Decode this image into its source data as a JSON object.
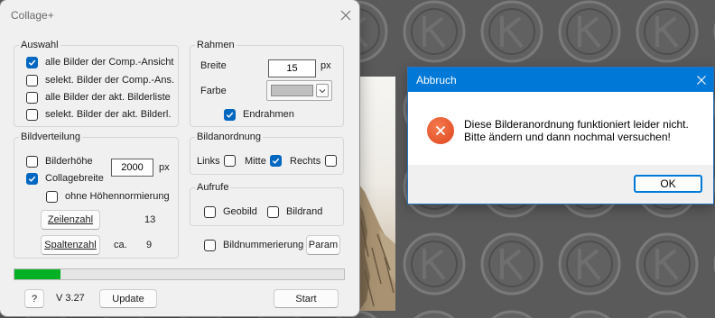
{
  "colors": {
    "checkbox_accent": "#0067c0",
    "title_bar": "#0078d7",
    "progress_fill": "#06b025",
    "error_icon": "#e0451f"
  },
  "collage_window": {
    "title": "Collage+",
    "close_icon": "close-icon",
    "auswahl": {
      "label": "Auswahl",
      "items": [
        {
          "label": "alle Bilder der Comp.-Ansicht",
          "checked": true
        },
        {
          "label": "selekt. Bilder der Comp.-Ans.",
          "checked": false
        },
        {
          "label": "alle Bilder der akt. Bilderliste",
          "checked": false
        },
        {
          "label": "selekt. Bilder der akt. Bilderl.",
          "checked": false
        }
      ]
    },
    "rahmen": {
      "label": "Rahmen",
      "breite_label": "Breite",
      "breite_value": "15",
      "breite_unit": "px",
      "farbe_label": "Farbe",
      "farbe_color": "#c0c0c0",
      "endrahmen_label": "Endrahmen",
      "endrahmen_checked": true
    },
    "bildverteilung": {
      "label": "Bildverteilung",
      "bilderhoehe_label": "Bilderhöhe",
      "bilderhoehe_checked": false,
      "size_value": "2000",
      "size_unit": "px",
      "collagebreite_label": "Collagebreite",
      "collagebreite_checked": true,
      "ohne_normierung_label": "ohne Höhennormierung",
      "ohne_normierung_checked": false,
      "zeilenzahl_button": "Zeilenzahl",
      "zeilenzahl_value": "13",
      "spaltenzahl_button": "Spaltenzahl",
      "spaltenzahl_prefix": "ca.",
      "spaltenzahl_value": "9"
    },
    "bildanordnung": {
      "label": "Bildanordnung",
      "links_label": "Links",
      "links_checked": false,
      "mitte_label": "Mitte",
      "mitte_checked": true,
      "rechts_label": "Rechts",
      "rechts_checked": false
    },
    "aufrufe": {
      "label": "Aufrufe",
      "geobild_label": "Geobild",
      "geobild_checked": false,
      "bildrand_label": "Bildrand",
      "bildrand_checked": false
    },
    "bildnummerierung": {
      "label": "Bildnummerierung",
      "checked": false
    },
    "param_button": "Param",
    "progress": 0.14,
    "help_button": "?",
    "version": "V 3.27",
    "update_button": "Update",
    "start_button": "Start"
  },
  "message_box": {
    "title": "Abbruch",
    "close_icon": "close-icon",
    "icon": "error-icon",
    "lines": [
      "Diese Bilderanordnung funktioniert leider nicht.",
      "Bitte ändern und dann nochmal versuchen!"
    ],
    "ok_button": "OK"
  }
}
